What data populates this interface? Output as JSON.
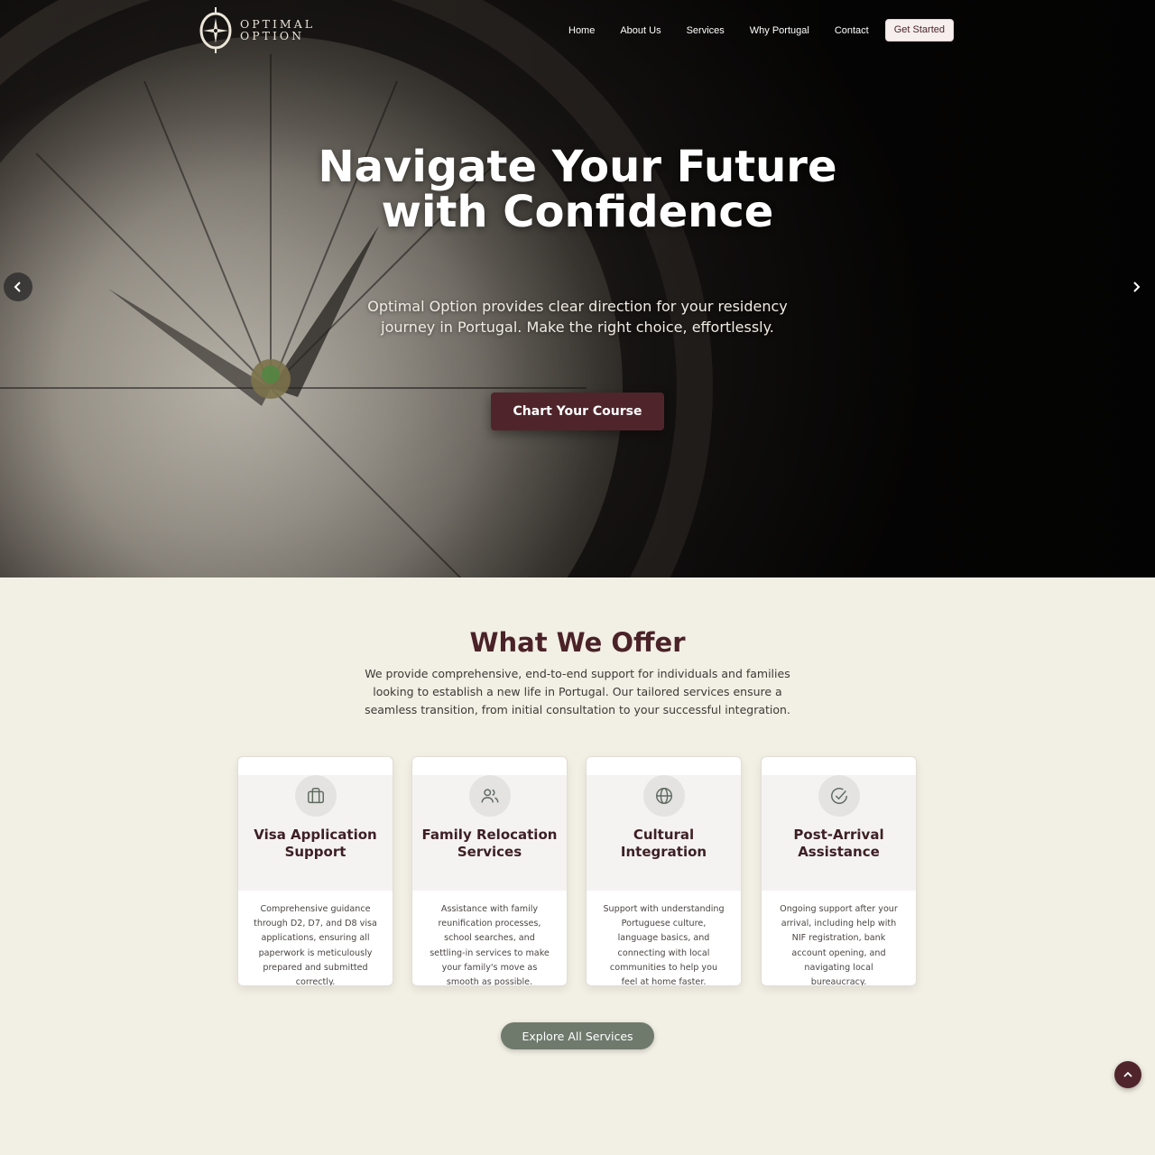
{
  "brand": {
    "line1": "OPTIMAL",
    "line2": "OPTION"
  },
  "nav": {
    "links": [
      "Home",
      "About Us",
      "Services",
      "Why Portugal",
      "Contact"
    ],
    "cta": "Get Started"
  },
  "hero": {
    "title": "Navigate Your Future with Confidence",
    "subtitle": "Optimal Option provides clear direction for your residency journey in Portugal. Make the right choice, effortlessly.",
    "cta": "Chart Your Course",
    "prev_icon": "chevron-left-icon",
    "next_icon": "chevron-right-icon"
  },
  "offer": {
    "title": "What We Offer",
    "description": "We provide comprehensive, end-to-end support for individuals and families looking to establish a new life in Portugal. Our tailored services ensure a seamless transition, from initial consultation to your successful integration.",
    "cards": [
      {
        "icon": "briefcase-icon",
        "title": "Visa Application Support",
        "text": "Comprehensive guidance through D2, D7, and D8 visa applications, ensuring all paperwork is meticulously prepared and submitted correctly."
      },
      {
        "icon": "users-icon",
        "title": "Family Relocation Services",
        "text": "Assistance with family reunification processes, school searches, and settling-in services to make your family's move as smooth as possible."
      },
      {
        "icon": "globe-icon",
        "title": "Cultural Integration",
        "text": "Support with understanding Portuguese culture, language basics, and connecting with local communities to help you feel at home faster."
      },
      {
        "icon": "check-circle-icon",
        "title": "Post-Arrival Assistance",
        "text": "Ongoing support after your arrival, including help with NIF registration, bank account opening, and navigating local bureaucracy."
      }
    ],
    "button": "Explore All Services"
  },
  "scroll_top_icon": "chevron-up-icon",
  "colors": {
    "primary": "#4f252b",
    "secondary": "#6f7a6d",
    "background": "#f2efe4"
  }
}
